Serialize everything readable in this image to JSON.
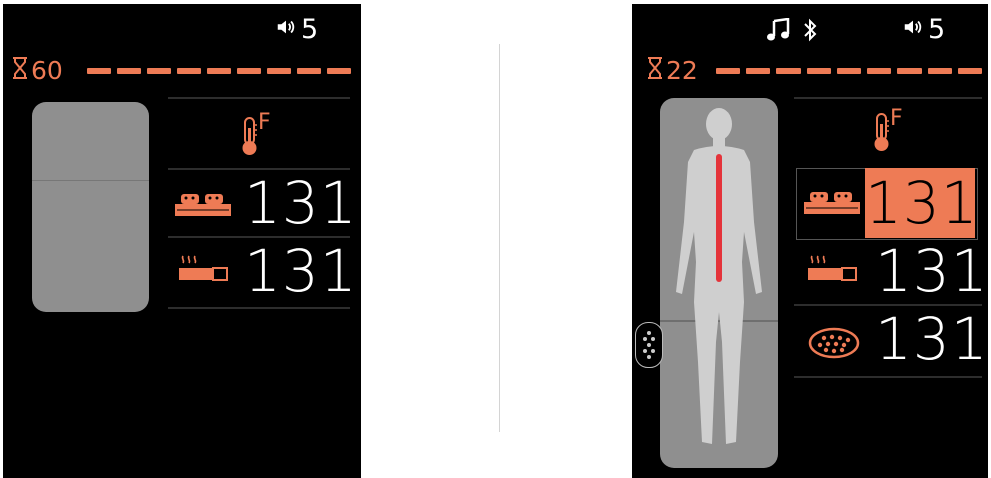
{
  "left_screen": {
    "volume": {
      "icon": "speaker-icon",
      "level": "5"
    },
    "timer": {
      "icon": "hourglass-icon",
      "value": "60"
    },
    "temperature": {
      "icon": "thermometer-icon",
      "unit": "F"
    },
    "rows": [
      {
        "icon": "mattress-icon",
        "value": "131"
      },
      {
        "icon": "heater-icon",
        "value": "131"
      }
    ]
  },
  "right_screen": {
    "status_icons": [
      "music-note-icon",
      "bluetooth-icon"
    ],
    "volume": {
      "icon": "speaker-icon",
      "level": "5"
    },
    "timer": {
      "icon": "hourglass-icon",
      "value": "22"
    },
    "temperature": {
      "icon": "thermometer-icon",
      "unit": "F"
    },
    "rows": [
      {
        "icon": "mattress-icon",
        "value": "131",
        "selected": true
      },
      {
        "icon": "heater-icon",
        "value": "131"
      },
      {
        "icon": "stone-pad-icon",
        "value": "131"
      }
    ]
  },
  "colors": {
    "accent": "#ee7b55",
    "screen_bg": "#000000",
    "pad": "#8f8f8f",
    "body": "#cfcfcf",
    "spine": "#e4333a"
  }
}
